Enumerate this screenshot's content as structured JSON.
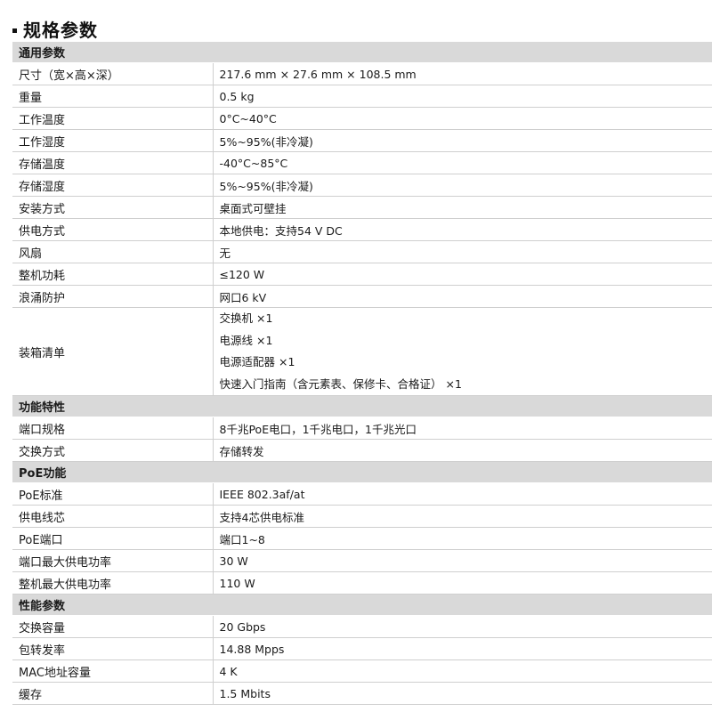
{
  "page_title": "规格参数",
  "sections": [
    {
      "header": "通用参数",
      "rows": [
        {
          "key": "尺寸（宽×高×深）",
          "value": "217.6 mm × 27.6 mm × 108.5 mm"
        },
        {
          "key": "重量",
          "value": "0.5 kg"
        },
        {
          "key": "工作温度",
          "value": "0°C~40°C"
        },
        {
          "key": "工作湿度",
          "value": "5%~95%(非冷凝)"
        },
        {
          "key": "存储温度",
          "value": "-40°C~85°C"
        },
        {
          "key": "存储湿度",
          "value": "5%~95%(非冷凝)"
        },
        {
          "key": "安装方式",
          "value": "桌面式可壁挂"
        },
        {
          "key": "供电方式",
          "value": "本地供电：支持54 V DC"
        },
        {
          "key": "风扇",
          "value": "无"
        },
        {
          "key": "整机功耗",
          "value": "≤120 W"
        },
        {
          "key": "浪涌防护",
          "value": "网口6 kV"
        },
        {
          "key": "装箱清单",
          "values": [
            "交换机 ×1",
            "电源线 ×1",
            "电源适配器 ×1",
            "快速入门指南（含元素表、保修卡、合格证） ×1"
          ]
        }
      ]
    },
    {
      "header": "功能特性",
      "rows": [
        {
          "key": "端口规格",
          "value": "8千兆PoE电口，1千兆电口，1千兆光口"
        },
        {
          "key": "交换方式",
          "value": "存储转发"
        }
      ]
    },
    {
      "header": "PoE功能",
      "rows": [
        {
          "key": "PoE标准",
          "value": "IEEE 802.3af/at"
        },
        {
          "key": "供电线芯",
          "value": "支持4芯供电标准"
        },
        {
          "key": "PoE端口",
          "value": "端口1~8"
        },
        {
          "key": "端口最大供电功率",
          "value": "30 W"
        },
        {
          "key": "整机最大供电功率",
          "value": "110 W"
        }
      ]
    },
    {
      "header": "性能参数",
      "rows": [
        {
          "key": "交换容量",
          "value": "20 Gbps"
        },
        {
          "key": "包转发率",
          "value": "14.88 Mpps"
        },
        {
          "key": "MAC地址容量",
          "value": "4 K"
        },
        {
          "key": "缓存",
          "value": "1.5 Mbits"
        }
      ]
    }
  ]
}
